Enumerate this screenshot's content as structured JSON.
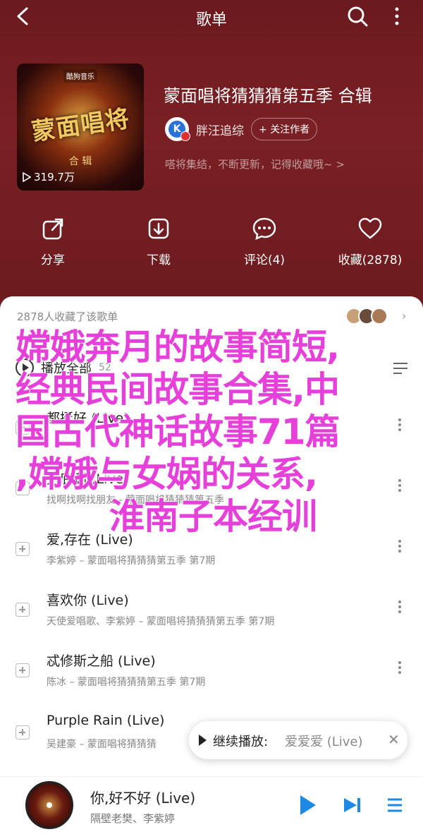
{
  "header": {
    "title": "歌单",
    "back_icon": "back-arrow-icon",
    "search_icon": "search-icon",
    "more_icon": "more-vertical-icon"
  },
  "playlist": {
    "cover_brand": "酷狗音乐",
    "cover_art_title": "蒙面唱将",
    "cover_art_sub": "合 辑",
    "play_count": "319.7万",
    "title": "蒙面唱将猜猜猜第五季 合辑",
    "author": "胖汪追综",
    "follow_label": "+ 关注作者",
    "description": "嗒将集结，不断更新，记得收藏哦~ >"
  },
  "actions": [
    {
      "label": "分享",
      "icon": "share-icon"
    },
    {
      "label": "下载",
      "icon": "download-icon"
    },
    {
      "label": "评论(4)",
      "icon": "comment-icon"
    },
    {
      "label": "收藏(2878)",
      "icon": "heart-icon"
    }
  ],
  "sheet": {
    "collect_text": "2878人收藏了该歌单",
    "play_all": "播放全部",
    "count": "52",
    "songs": [
      {
        "title": "都挺好 (Live)",
        "sub": ""
      },
      {
        "title": "无底洞 (Live)",
        "sub": "找啊找啊找朋友 - 蒙面唱将猜猜猜第五季"
      },
      {
        "title": "爱,存在 (Live)",
        "sub": "李紫婷 – 蒙面唱将猜猜猜第五季 第7期"
      },
      {
        "title": "喜欢你 (Live)",
        "sub": "天使爱唱歌、李紫婷 – 蒙面唱将猜猜猜第五季 第7期"
      },
      {
        "title": "忒修斯之船 (Live)",
        "sub": "陈冰 – 蒙面唱将猜猜猜第五季 第7期"
      },
      {
        "title": "Purple Rain (Live)",
        "sub": "吴建豪 – 蒙面唱将猜猜猜"
      }
    ]
  },
  "overlay": {
    "line1": "嫦娥奔月的故事简短,",
    "line2": "经典民间故事合集,中",
    "line3": "国古代神话故事71篇",
    "line4": ",嫦娥与女娲的关系,",
    "line5": "淮南子本经训"
  },
  "continue_bar": {
    "label": "继续播放:",
    "song": "爱爱爱 (Live)"
  },
  "player": {
    "title": "你,好不好 (Live)",
    "artist": "隔壁老樊、李紫婷"
  },
  "colors": {
    "accent": "#1e88e5",
    "overlay": "#e540d9",
    "bg": "#6b1a1f"
  }
}
